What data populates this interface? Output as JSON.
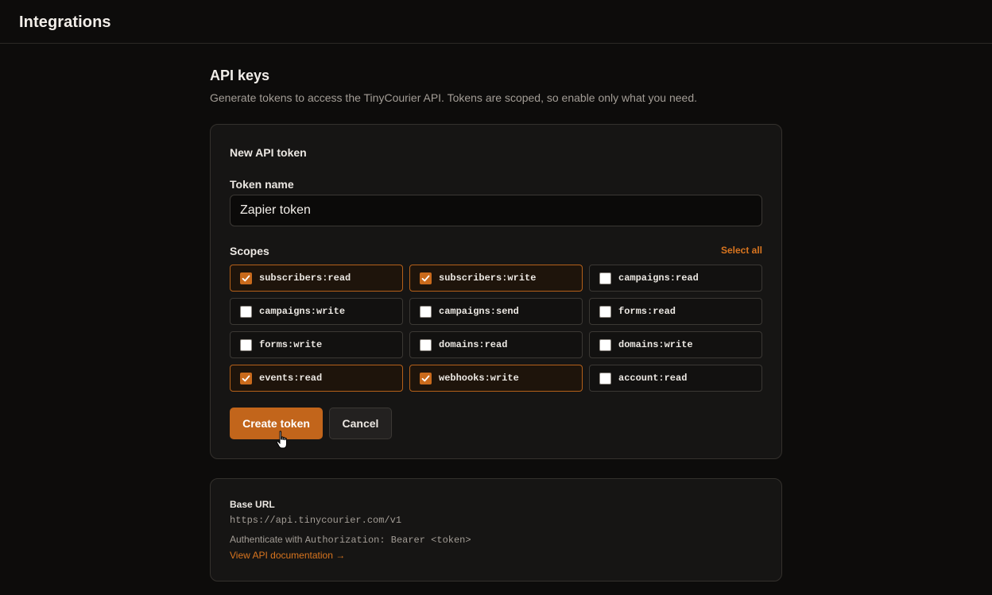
{
  "header": {
    "title": "Integrations"
  },
  "section": {
    "title": "API keys",
    "description": "Generate tokens to access the TinyCourier API. Tokens are scoped, so enable only what you need."
  },
  "token_form": {
    "card_title": "New API token",
    "name_label": "Token name",
    "name_value": "Zapier token",
    "scopes_label": "Scopes",
    "select_all_label": "Select all",
    "scopes": [
      {
        "label": "subscribers:read",
        "checked": true
      },
      {
        "label": "subscribers:write",
        "checked": true
      },
      {
        "label": "campaigns:read",
        "checked": false
      },
      {
        "label": "campaigns:write",
        "checked": false
      },
      {
        "label": "campaigns:send",
        "checked": false
      },
      {
        "label": "forms:read",
        "checked": false
      },
      {
        "label": "forms:write",
        "checked": false
      },
      {
        "label": "domains:read",
        "checked": false
      },
      {
        "label": "domains:write",
        "checked": false
      },
      {
        "label": "events:read",
        "checked": true
      },
      {
        "label": "webhooks:write",
        "checked": true
      },
      {
        "label": "account:read",
        "checked": false
      }
    ],
    "create_label": "Create token",
    "cancel_label": "Cancel"
  },
  "base_info": {
    "title": "Base URL",
    "url": "https://api.tinycourier.com/v1",
    "auth_prefix": "Authenticate with",
    "auth_code": "Authorization: Bearer <token>",
    "doc_link": "View API documentation →"
  },
  "colors": {
    "accent": "#c2651b",
    "background": "#0d0c0b",
    "card": "#161514"
  },
  "icons": {
    "checkbox_checked": "check-icon",
    "cursor": "hand-pointer-icon"
  }
}
